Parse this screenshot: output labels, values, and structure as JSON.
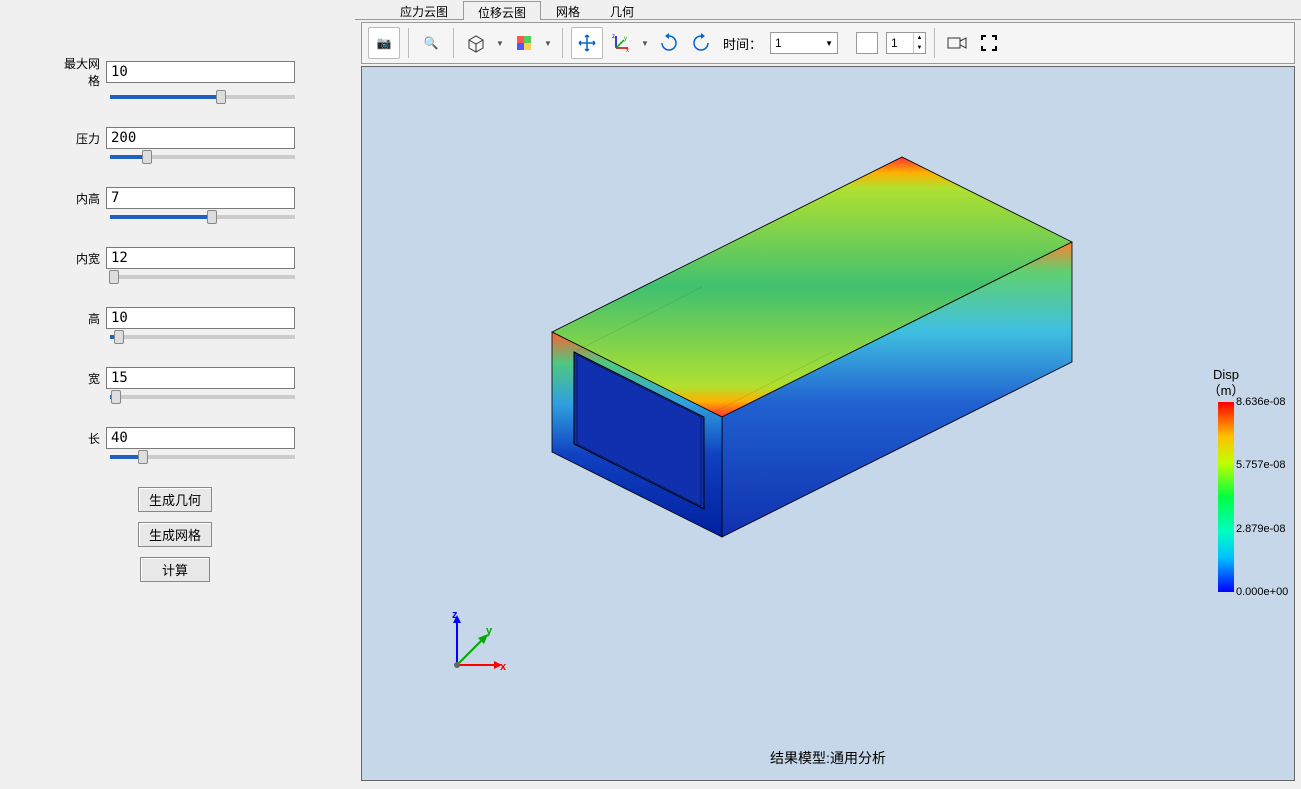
{
  "sidebar": {
    "params": [
      {
        "label": "最大网格",
        "value": "10",
        "pct": 60
      },
      {
        "label": "压力",
        "value": "200",
        "pct": 20
      },
      {
        "label": "内高",
        "value": "7",
        "pct": 55
      },
      {
        "label": "内宽",
        "value": "12",
        "pct": 2
      },
      {
        "label": "高",
        "value": "10",
        "pct": 5
      },
      {
        "label": "宽",
        "value": "15",
        "pct": 3
      },
      {
        "label": "长",
        "value": "40",
        "pct": 18
      }
    ],
    "buttons": {
      "gen_geom": "生成几何",
      "gen_mesh": "生成网格",
      "compute": "计算"
    }
  },
  "tabs": {
    "items": [
      "应力云图",
      "位移云图",
      "网格",
      "几何"
    ],
    "active": 1
  },
  "toolbar": {
    "time_label": "时间：",
    "time_select": "1",
    "frame_value": "1"
  },
  "viewport": {
    "caption": "结果模型:通用分析",
    "axis": {
      "x": "x",
      "y": "y",
      "z": "z"
    },
    "legend": {
      "title": "Disp",
      "unit": "（m）",
      "ticks": [
        {
          "label": "8.636e-08",
          "pos": 0
        },
        {
          "label": "5.757e-08",
          "pos": 33
        },
        {
          "label": "2.879e-08",
          "pos": 67
        },
        {
          "label": "0.000e+00",
          "pos": 100
        }
      ]
    }
  },
  "chart_data": {
    "type": "3d-contour",
    "variable": "Displacement",
    "unit": "m",
    "range": [
      0.0,
      8.636e-08
    ],
    "colorbar_ticks": [
      0.0,
      2.879e-08,
      5.757e-08,
      8.636e-08
    ],
    "geometry": {
      "type": "hollow_rectangular_tube",
      "length": 40,
      "width": 15,
      "height": 10,
      "inner_width": 12,
      "inner_height": 7
    }
  }
}
